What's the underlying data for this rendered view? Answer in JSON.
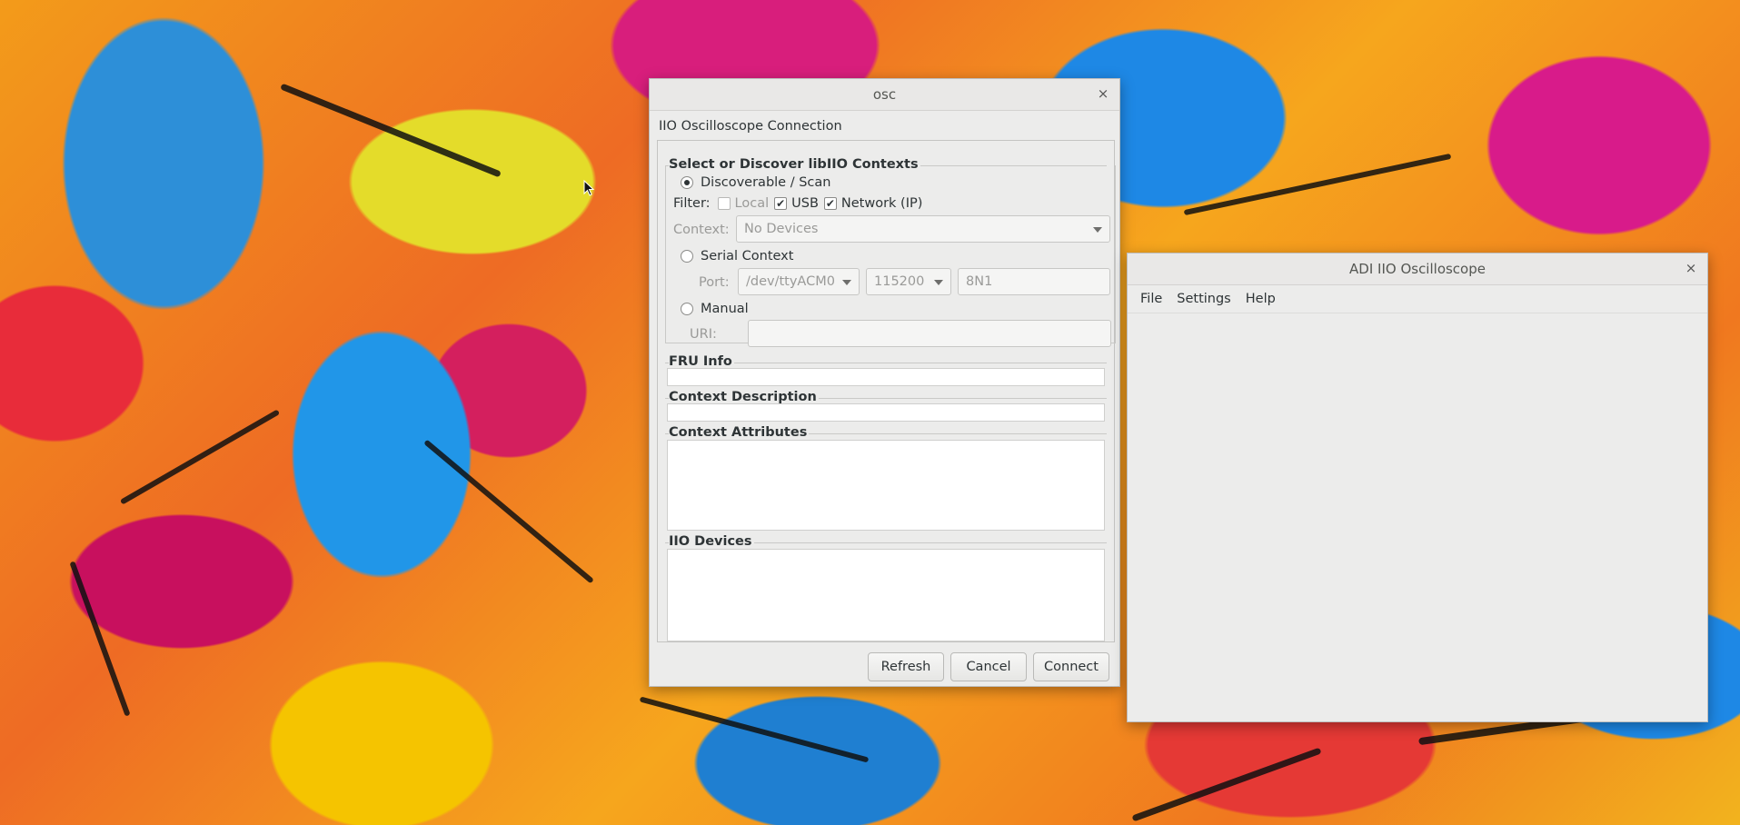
{
  "osc_window": {
    "title": "osc",
    "close_glyph": "×",
    "heading": "IIO Oscilloscope Connection",
    "contexts_group": {
      "label": "Select or Discover libIIO Contexts",
      "discoverable_label": "Discoverable / Scan",
      "filter_label": "Filter:",
      "filter_local": "Local",
      "filter_usb": "USB",
      "filter_network": "Network (IP)",
      "context_label": "Context:",
      "context_value": "No Devices",
      "serial_label": "Serial Context",
      "port_label": "Port:",
      "port_value": "/dev/ttyACM0",
      "baud_value": "115200",
      "serial_config_value": "8N1",
      "manual_label": "Manual",
      "uri_label": "URI:",
      "uri_value": ""
    },
    "fru_info_label": "FRU Info",
    "context_description_label": "Context Description",
    "context_attributes_label": "Context Attributes",
    "iio_devices_label": "IIO Devices",
    "buttons": {
      "refresh": "Refresh",
      "cancel": "Cancel",
      "connect": "Connect"
    }
  },
  "adi_window": {
    "title": "ADI IIO Oscilloscope",
    "close_glyph": "×",
    "menu": [
      "File",
      "Settings",
      "Help"
    ]
  },
  "check_glyph": "✔"
}
